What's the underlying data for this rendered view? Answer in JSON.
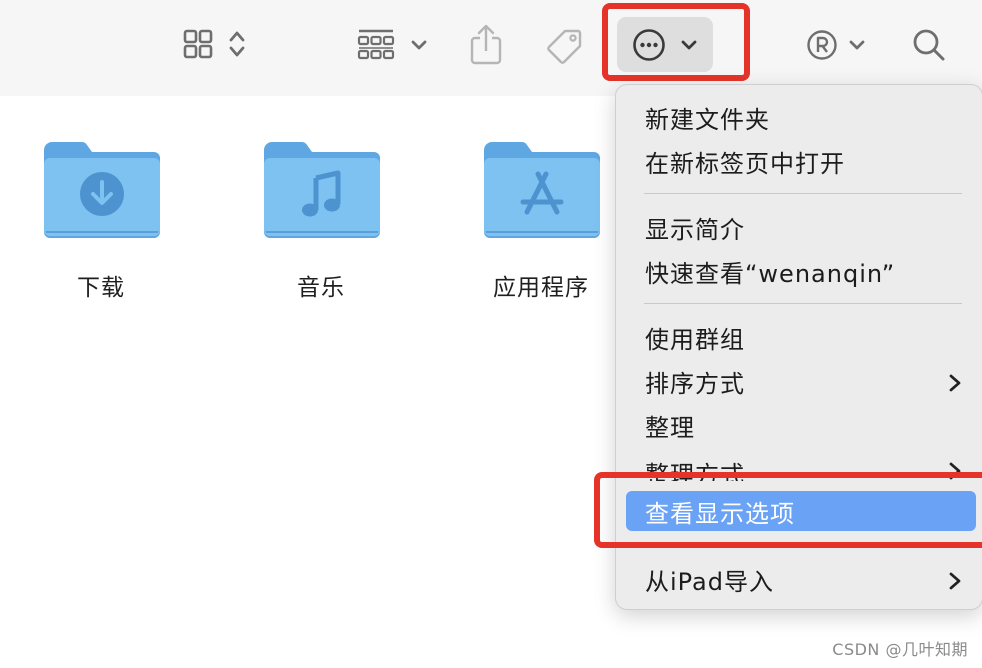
{
  "toolbar": {
    "icons": [
      "view-grid-icon",
      "up-down-chevron-icon",
      "group-icon",
      "chevron-down-icon",
      "share-icon",
      "tag-icon",
      "more-actions-icon",
      "chevron-down-icon",
      "registered-icon",
      "chevron-down-icon",
      "search-icon"
    ]
  },
  "folders": [
    {
      "label": "下载",
      "icon": "download-icon"
    },
    {
      "label": "音乐",
      "icon": "music-note-icon"
    },
    {
      "label": "应用程序",
      "icon": "app-store-icon"
    }
  ],
  "menu": {
    "items": [
      {
        "label": "新建文件夹"
      },
      {
        "label": "在新标签页中打开"
      },
      {
        "label": "显示简介"
      },
      {
        "label": "快速查看“wenanqin”"
      },
      {
        "label": "使用群组"
      },
      {
        "label": "排序方式",
        "submenu": true
      },
      {
        "label": "整理"
      },
      {
        "label": "整理方式",
        "submenu": true
      },
      {
        "label": "查看显示选项",
        "highlighted": true
      },
      {
        "label": "从iPad导入",
        "submenu": true
      }
    ]
  },
  "watermark": "CSDN @几叶知期",
  "colors": {
    "annotation": "#e6332a",
    "selection": "#6aa2f5",
    "folder": "#6cb4ea"
  }
}
